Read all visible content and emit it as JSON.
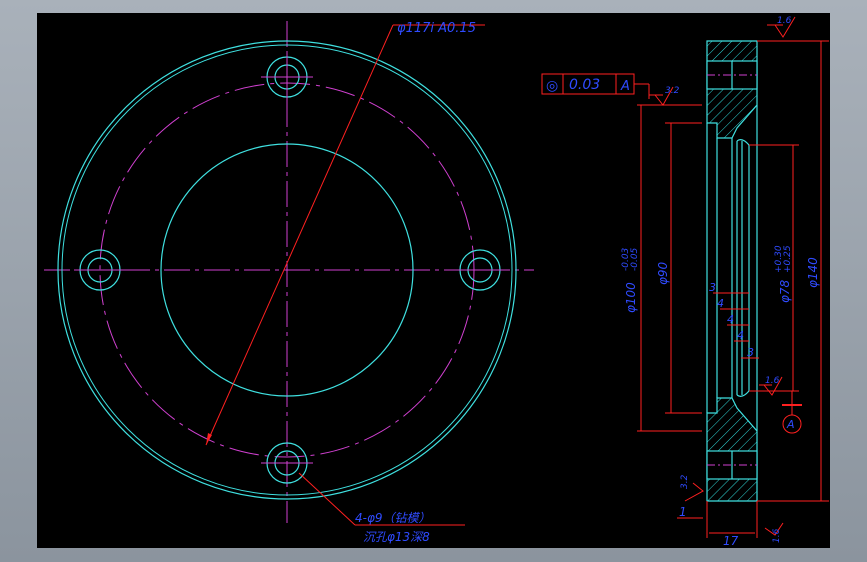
{
  "drawing": {
    "colors": {
      "outline": "#3fe0e0",
      "centerline": "#d040d0",
      "dimension": "#2f4bff",
      "leader": "#ff2020",
      "hatch": "#2fd8d8",
      "background": "#000000"
    },
    "front_view": {
      "bolt_circle_label": "φ117i A0.15",
      "hole_note_line1": "4-φ9（钻模）",
      "hole_note_line2": "沉孔φ13深8"
    },
    "section_view": {
      "tolerance_frame": [
        "◎",
        "0.03",
        "A"
      ],
      "roughness_top": "1.6",
      "roughness_left": "3.2",
      "roughness_inner": "1.6",
      "roughness_lower_left": "3.2",
      "roughness_bottom": "1.6",
      "datum": "A",
      "dim_d100": "φ100",
      "dim_d100_upper": "-0.03",
      "dim_d100_lower": "-0.05",
      "dim_d90": "φ90",
      "dim_d78": "φ78",
      "dim_d78_upper": "+0.30",
      "dim_d78_lower": "+0.25",
      "dim_d140": "φ140",
      "groove_1": "3",
      "groove_2": "4",
      "groove_3": "4",
      "groove_4": "4",
      "groove_5": "3",
      "dim_step": "1",
      "dim_thickness": "17"
    }
  }
}
